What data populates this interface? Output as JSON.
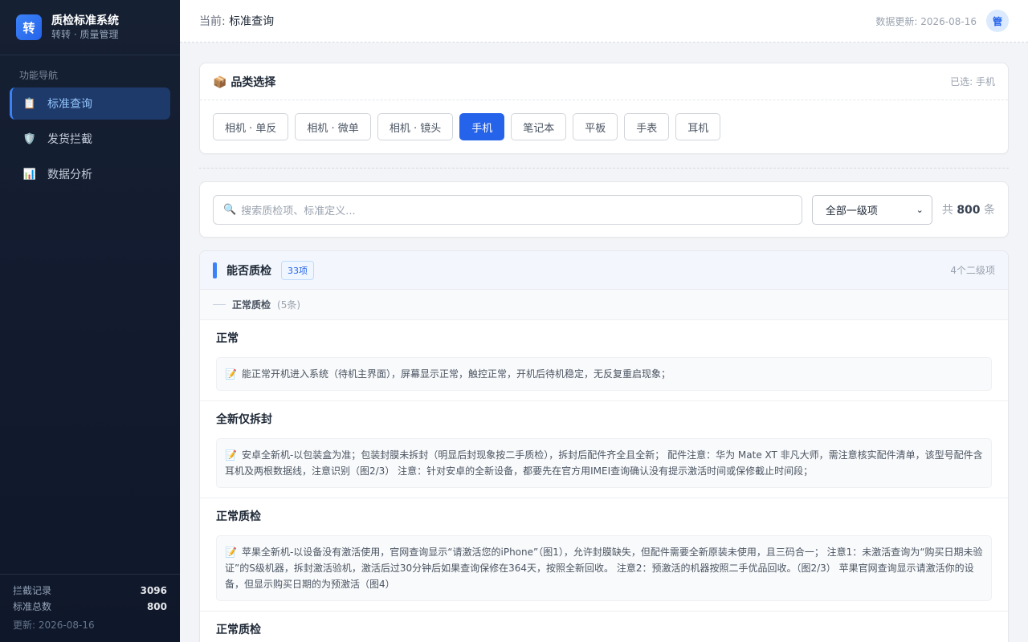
{
  "brand": {
    "logo_char": "转",
    "title": "质检标准系统",
    "subtitle": "转转 · 质量管理"
  },
  "nav": {
    "heading": "功能导航",
    "items": [
      {
        "icon": "📋",
        "label": "标准查询",
        "active": true
      },
      {
        "icon": "🛡️",
        "label": "发货拦截",
        "active": false
      },
      {
        "icon": "📊",
        "label": "数据分析",
        "active": false
      }
    ]
  },
  "sidebar_footer": {
    "intercept_label": "拦截记录",
    "intercept_value": "3096",
    "standards_label": "标准总数",
    "standards_value": "800",
    "updated": "更新: 2026-08-16"
  },
  "topbar": {
    "crumb_prefix": "当前:",
    "crumb_current": "标准查询",
    "data_updated": "数据更新: 2026-08-16",
    "avatar": "管"
  },
  "category": {
    "icon": "📦",
    "title": "品类选择",
    "selected": "已选: 手机",
    "chips": [
      "相机 · 单反",
      "相机 · 微单",
      "相机 · 镜头",
      "手机",
      "笔记本",
      "平板",
      "手表",
      "耳机"
    ],
    "active_index": 3
  },
  "search": {
    "placeholder": "搜索质检项、标准定义...",
    "select_value": "全部一级项",
    "count_prefix": "共",
    "count_value": "800",
    "count_suffix": "条"
  },
  "section": {
    "title": "能否质检",
    "badge": "33项",
    "right": "4个二级项",
    "sub_title": "正常质检",
    "sub_count": "(5条)",
    "items": [
      {
        "title": "正常",
        "desc": "能正常开机进入系统（待机主界面），屏幕显示正常，触控正常，开机后待机稳定，无反复重启现象；"
      },
      {
        "title": "全新仅拆封",
        "desc": "安卓全新机-以包装盒为准；包装封膜未拆封（明显后封现象按二手质检），拆封后配件齐全且全新； 配件注意：华为 Mate XT 非凡大师，需注意核实配件清单，该型号配件含耳机及两根数据线，注意识别（图2/3） 注意：针对安卓的全新设备，都要先在官方用IMEI查询确认没有提示激活时间或保修截止时间段；"
      },
      {
        "title": "正常质检",
        "desc": "苹果全新机-以设备没有激活使用，官网查询显示“请激活您的iPhone”（图1），允许封膜缺失，但配件需要全新原装未使用，且三码合一； 注意1：未激活查询为“购买日期未验证”的S级机器，拆封激活验机，激活后过30分钟后如果查询保修在364天，按照全新回收。 注意2：预激活的机器按照二手优品回收。（图2/3） 苹果官网查询显示请激活你的设备，但显示购买日期的为预激活（图4）"
      },
      {
        "title": "正常质检",
        "desc": ""
      }
    ]
  },
  "colors": {
    "accent": "#2563eb",
    "sidebar_bg": "#0f172a"
  }
}
